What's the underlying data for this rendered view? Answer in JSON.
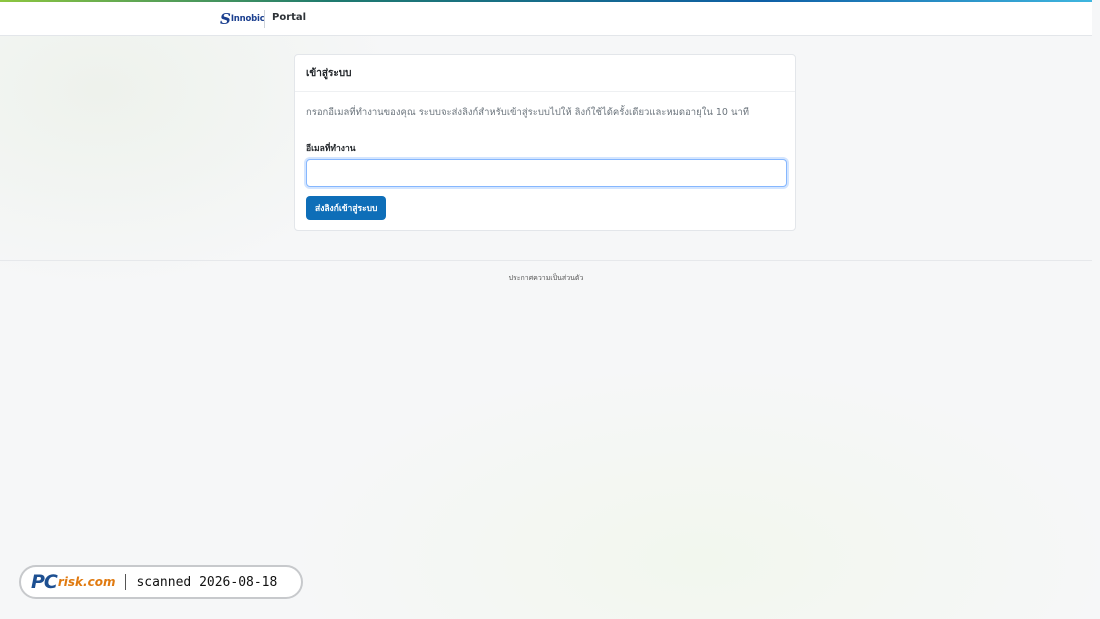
{
  "header": {
    "logo_text": "Innobic",
    "logo_mark": "S",
    "portal_label": "Portal"
  },
  "login_card": {
    "title": "เข้าสู่ระบบ",
    "description": "กรอกอีเมลที่ทำงานของคุณ ระบบจะส่งลิงก์สำหรับเข้าสู่ระบบไปให้ ลิงก์ใช้ได้ครั้งเดียวและหมดอายุใน 10 นาที",
    "email_label": "อีเมลที่ทำงาน",
    "email_value": "",
    "submit_label": "ส่งลิงก์เข้าสู่ระบบ"
  },
  "footer": {
    "privacy_label": "ประกาศความเป็นส่วนตัว"
  },
  "watermark": {
    "brand_pc": "PC",
    "brand_risk": "risk.com",
    "scanned_text": "scanned 2026-08-18"
  },
  "colors": {
    "primary_button": "#0e6eb8",
    "brand_blue": "#1b3f8f",
    "accent_green": "#8dc63f"
  }
}
